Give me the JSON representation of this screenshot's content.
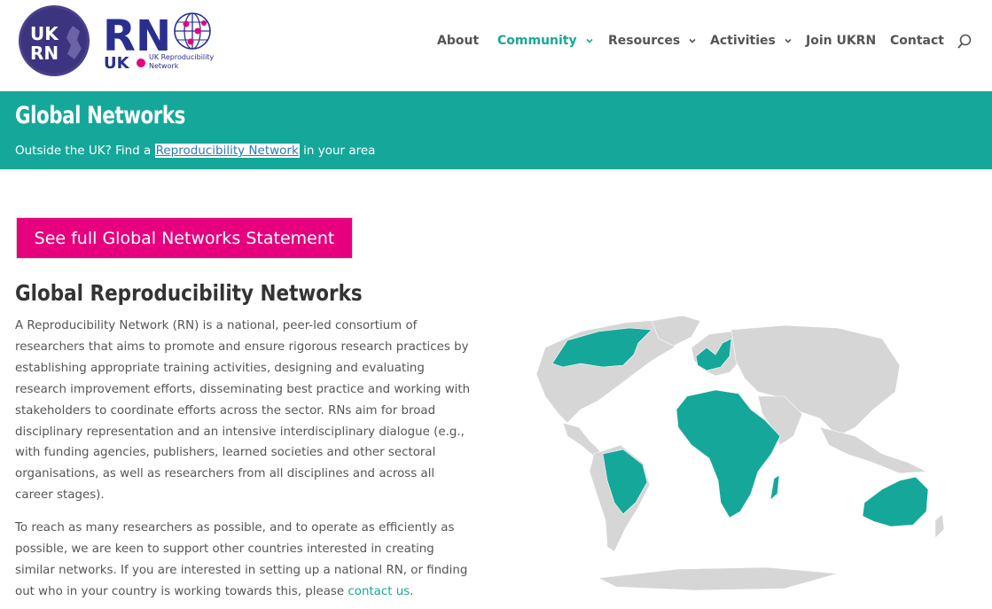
{
  "logo": {
    "badge_line1": "UK",
    "badge_line2": "RN",
    "wordmark": "RN",
    "wordmark_uk": "UK",
    "tagline_line1": "UK Reproducibility",
    "tagline_line2": "Network"
  },
  "nav": {
    "items": [
      {
        "label": "About",
        "has_dropdown": false
      },
      {
        "label": "Community",
        "has_dropdown": true,
        "active": true
      },
      {
        "label": "Resources",
        "has_dropdown": true
      },
      {
        "label": "Activities",
        "has_dropdown": true
      },
      {
        "label": "Join UKRN",
        "has_dropdown": false
      },
      {
        "label": "Contact",
        "has_dropdown": false
      }
    ],
    "search_icon": "search-icon"
  },
  "banner": {
    "title": "Global Networks",
    "subtitle_before": "Outside the UK? Find a ",
    "subtitle_link": "Reproducibility Network",
    "subtitle_after": " in your area"
  },
  "cta": {
    "label": "See full Global Networks Statement"
  },
  "content": {
    "heading": "Global Reproducibility Networks",
    "paragraph1": "A Reproducibility Network (RN) is a national, peer-led consortium of researchers that aims to promote and ensure rigorous research practices by establishing appropriate training activities, designing and evaluating research improvement efforts, disseminating best practice and working with stakeholders to coordinate efforts across the sector. RNs aim for broad disciplinary representation and an intensive interdisciplinary dialogue (e.g., with funding agencies, publishers, learned societies and other sectoral organisations, as well as researchers from all disciplines and across all career stages).",
    "paragraph2_before": "To reach as many researchers as possible, and to operate as efficiently as possible, we are keen to support other countries interested in creating similar networks. If you are interested in setting up a national RN, or finding out who in your country is working towards this, please ",
    "paragraph2_link": "contact us",
    "paragraph2_after": "."
  },
  "colors": {
    "brand_teal": "#15a89a",
    "nav_active": "#1aa797",
    "cta_magenta": "#e6007e",
    "logo_navy": "#2a2f8f",
    "map_grey": "#d6d6d6"
  }
}
